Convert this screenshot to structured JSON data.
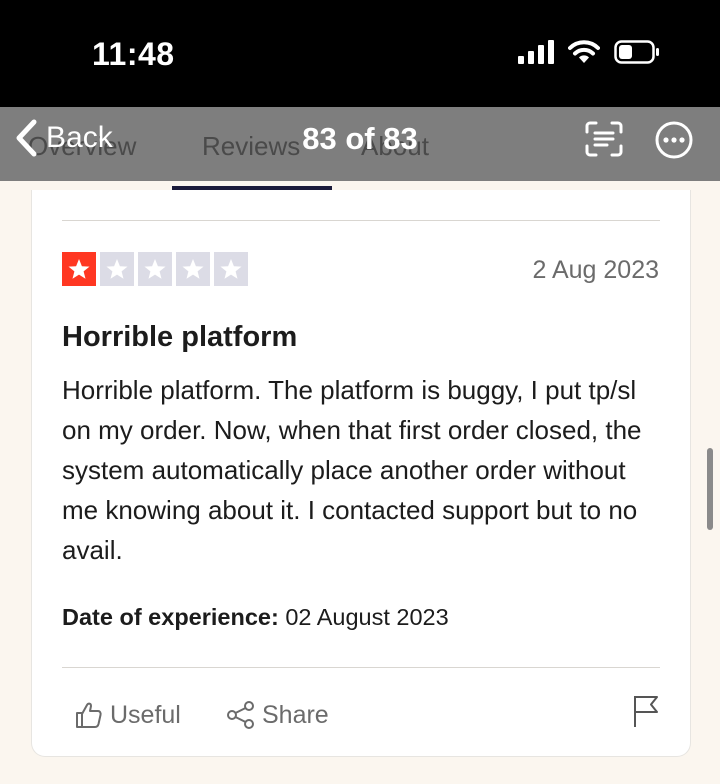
{
  "status_bar": {
    "time": "11:48"
  },
  "nav": {
    "back_label": "Back",
    "title": "83 of 83",
    "ghost_tabs": [
      "Overview",
      "Reviews",
      "About"
    ]
  },
  "review": {
    "rating": 1,
    "max_rating": 5,
    "date": "2 Aug 2023",
    "title": "Horrible platform",
    "body": "Horrible platform. The platform is buggy, I put tp/sl on my order. Now, when that first order closed, the system automatically place another order without me knowing about it. I contacted support but to no avail.",
    "experience_label": "Date of experience:",
    "experience_value": " 02 August 2023"
  },
  "actions": {
    "useful_label": "Useful",
    "share_label": "Share"
  },
  "colors": {
    "star_filled": "#ff3722",
    "star_empty": "#dcdce6",
    "nav_bg": "#7e7e7e"
  },
  "icons": [
    "signal-icon",
    "wifi-icon",
    "battery-icon",
    "chevron-left-icon",
    "scan-text-icon",
    "more-icon",
    "thumbs-up-icon",
    "share-icon",
    "flag-icon"
  ]
}
